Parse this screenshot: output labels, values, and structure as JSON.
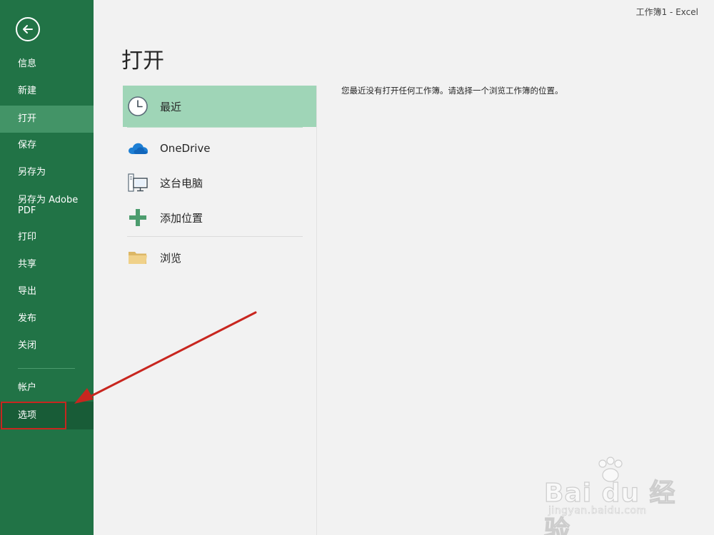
{
  "window": {
    "title": "工作簿1 - Excel"
  },
  "sidebar": {
    "back_icon": "back-arrow-icon",
    "items": [
      {
        "label": "信息"
      },
      {
        "label": "新建"
      },
      {
        "label": "打开"
      },
      {
        "label": "保存"
      },
      {
        "label": "另存为"
      },
      {
        "label": "另存为 Adobe PDF"
      },
      {
        "label": "打印"
      },
      {
        "label": "共享"
      },
      {
        "label": "导出"
      },
      {
        "label": "发布"
      },
      {
        "label": "关闭"
      },
      {
        "label": "帐户"
      },
      {
        "label": "选项"
      }
    ],
    "active_item": "打开",
    "highlighted_item": "选项"
  },
  "main": {
    "page_title": "打开",
    "locations": [
      {
        "label": "最近",
        "icon": "clock-icon"
      },
      {
        "label": "OneDrive",
        "icon": "cloud-icon"
      },
      {
        "label": "这台电脑",
        "icon": "computer-icon"
      },
      {
        "label": "添加位置",
        "icon": "plus-icon"
      },
      {
        "label": "浏览",
        "icon": "folder-icon"
      }
    ],
    "empty_message": "您最近没有打开任何工作簿。请选择一个浏览工作簿的位置。"
  },
  "watermark": {
    "text": "Bai du 经验",
    "subtext": "jingyan.baidu.com"
  },
  "colors": {
    "sidebar": "#217346",
    "sidebar_active": "#439467",
    "location_active": "#9fd5b7",
    "annotation": "#c8261f"
  }
}
